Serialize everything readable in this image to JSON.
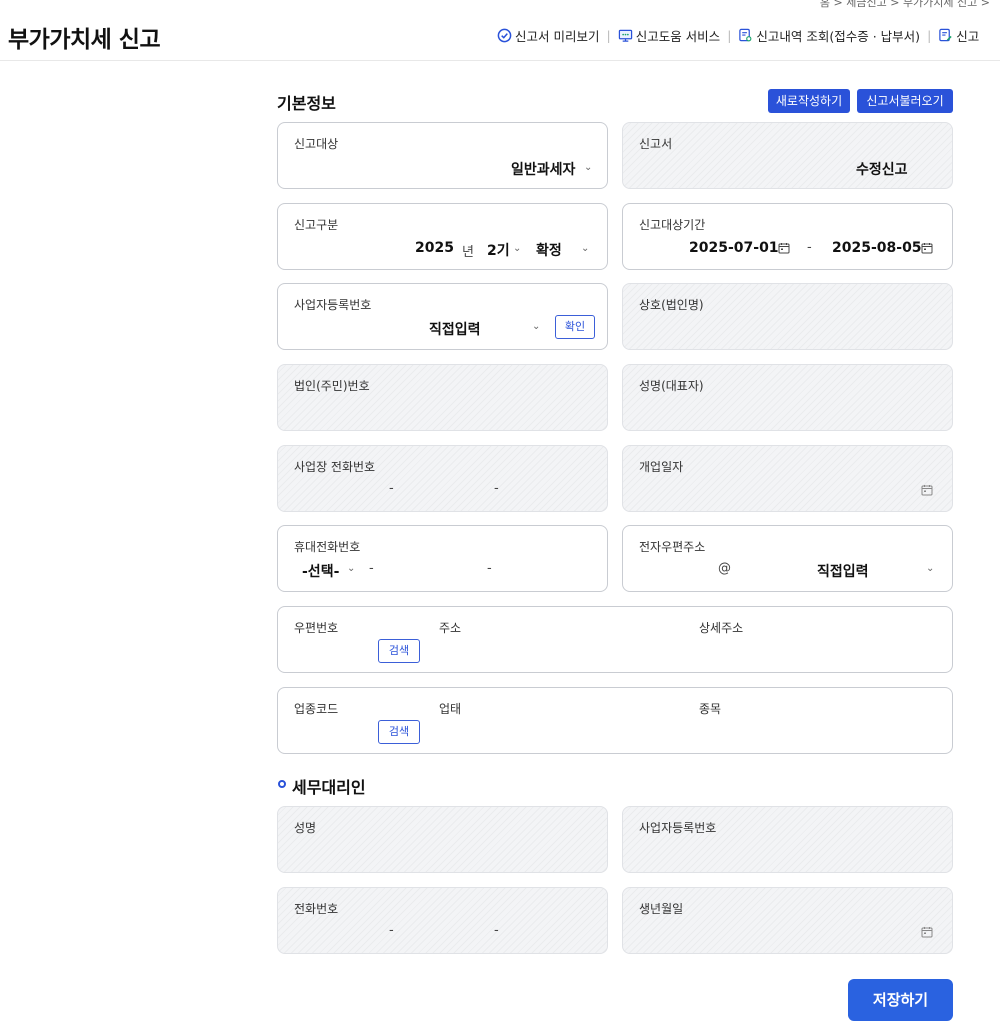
{
  "breadcrumb": "홈 > 세금신고 > 부가가치세 신고 >",
  "page_title": "부가가치세 신고",
  "top_links": {
    "preview": "신고서 미리보기",
    "help_service": "신고도움 서비스",
    "history": "신고내역 조회(접수증 · 납부서)",
    "more": "신고"
  },
  "basic_info": {
    "title": "기본정보",
    "new_button": "새로작성하기",
    "load_button": "신고서불러오기"
  },
  "fields": {
    "target": {
      "label": "신고대상",
      "value": "일반과세자"
    },
    "form": {
      "label": "신고서",
      "value": "수정신고"
    },
    "category": {
      "label": "신고구분",
      "year": "2025",
      "year_unit": "년",
      "period": "2기",
      "type": "확정"
    },
    "period_range": {
      "label": "신고대상기간",
      "start": "2025-07-01",
      "end": "2025-08-05",
      "sep": "-"
    },
    "biz_reg_no": {
      "label": "사업자등록번호",
      "value": "직접입력",
      "confirm": "확인"
    },
    "company_name": {
      "label": "상호(법인명)"
    },
    "corp_id_no": {
      "label": "법인(주민)번호"
    },
    "rep_name": {
      "label": "성명(대표자)"
    },
    "biz_phone": {
      "label": "사업장 전화번호",
      "sep": "-"
    },
    "open_date": {
      "label": "개업일자"
    },
    "mobile": {
      "label": "휴대전화번호",
      "value": "-선택-",
      "sep": "-"
    },
    "email": {
      "label": "전자우편주소",
      "at": "@",
      "domain": "직접입력"
    },
    "address": {
      "zip_label": "우편번호",
      "addr_label": "주소",
      "detail_label": "상세주소",
      "search": "검색"
    },
    "industry": {
      "code_label": "업종코드",
      "type_label": "업태",
      "item_label": "종목",
      "search": "검색"
    }
  },
  "tax_agent": {
    "title": "세무대리인",
    "name_label": "성명",
    "biz_no_label": "사업자등록번호",
    "phone_label": "전화번호",
    "phone_sep": "-",
    "birth_label": "생년월일"
  },
  "save_button": "저장하기",
  "colors": {
    "primary": "#2a52d9",
    "save": "#2a62e0",
    "readonly_bg": "#f3f4f6",
    "border": "#c9ccd2"
  }
}
